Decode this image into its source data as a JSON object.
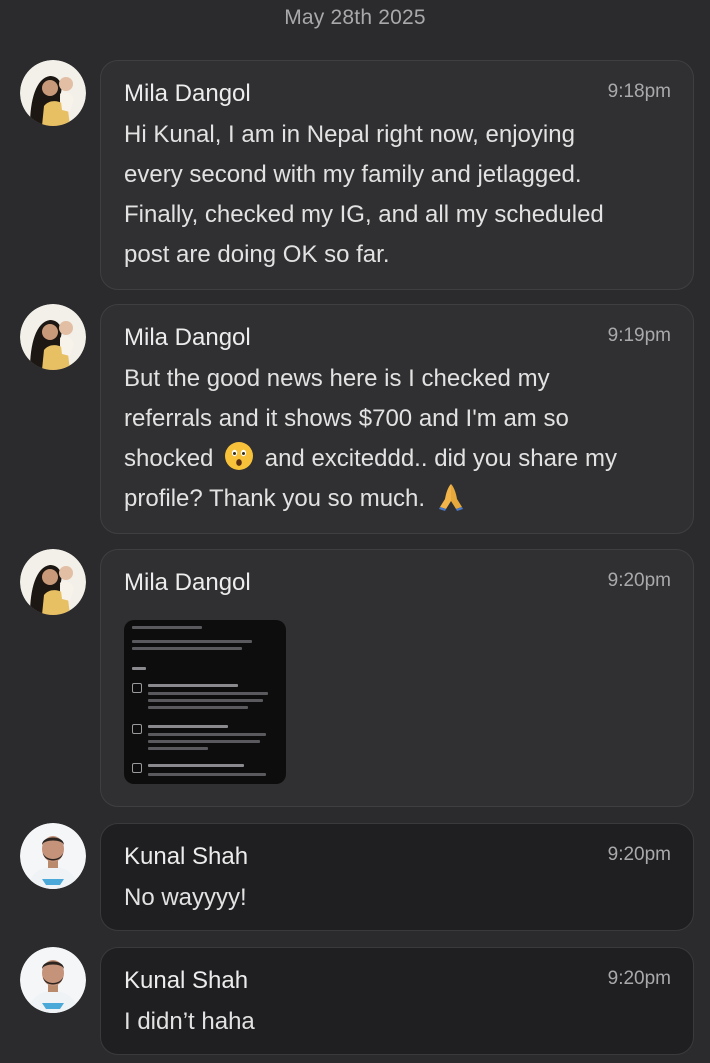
{
  "date_header": "May 28th 2025",
  "messages": [
    {
      "sender": "Mila Dangol",
      "time": "9:18pm",
      "lines": [
        "Hi Kunal, I am in Nepal right now, enjoying",
        "every second with my family and jetlagged.",
        "Finally, checked my IG, and all my scheduled",
        "post are doing OK so far."
      ]
    },
    {
      "sender": "Mila Dangol",
      "time": "9:19pm",
      "line1": "But the good news here is I checked my",
      "line2": "referrals and it shows $700 and I'm am so",
      "line3_a": "shocked",
      "line3_b": "and exciteddd.. did you share my",
      "line4": "profile? Thank you so much.",
      "emoji1": "astonished-face-emoji",
      "emoji2": "folded-hands-emoji"
    },
    {
      "sender": "Mila Dangol",
      "time": "9:20pm",
      "attachment": "instagram-referrals-screenshot-image"
    },
    {
      "sender": "Kunal Shah",
      "time": "9:20pm",
      "text": "No wayyyy!"
    },
    {
      "sender": "Kunal Shah",
      "time": "9:20pm",
      "text": "I didn’t haha"
    }
  ],
  "colors": {
    "background": "#2b2b2d",
    "incoming_bubble": "#303032",
    "outgoing_bubble": "#1f1f21",
    "muted_text": "#a9a9ac"
  }
}
